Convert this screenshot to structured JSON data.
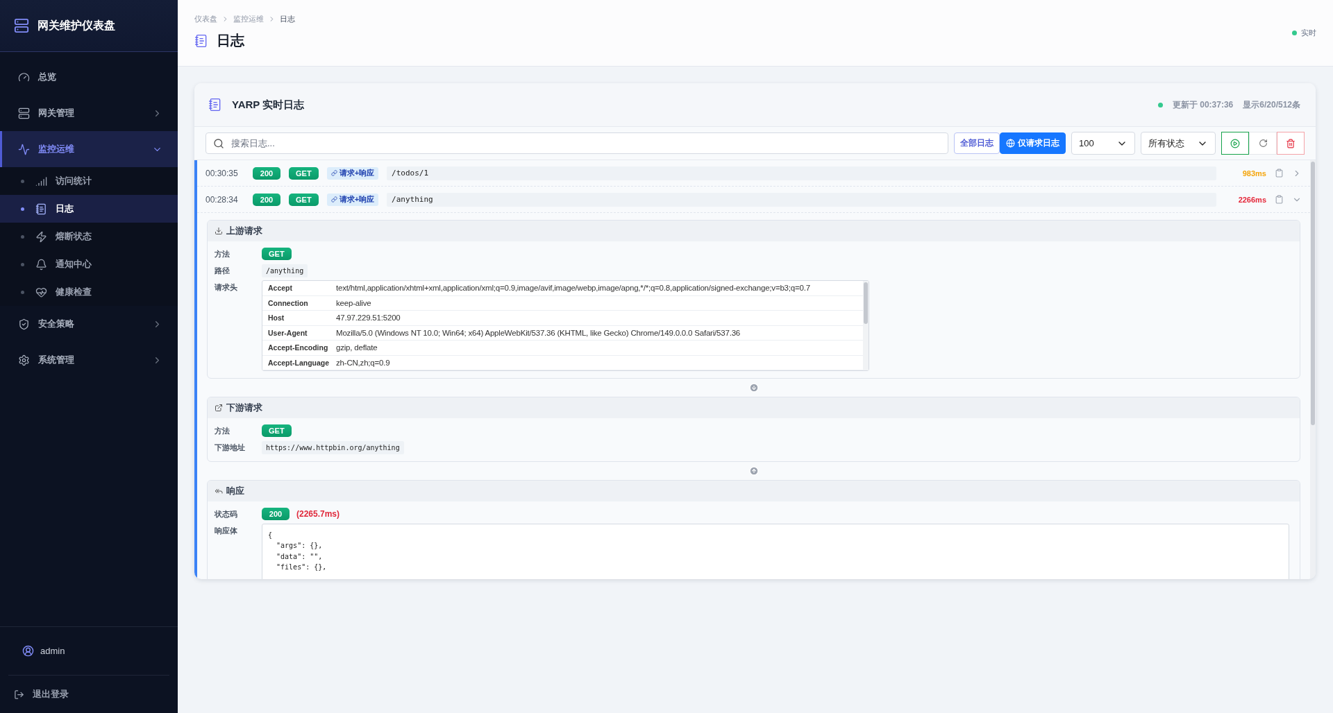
{
  "sidebar": {
    "title": "网关维护仪表盘",
    "items": [
      {
        "kind": "link",
        "label": "总览",
        "selected": false
      },
      {
        "kind": "group",
        "label": "网关管理",
        "selected": false,
        "expanded": false
      },
      {
        "kind": "group",
        "label": "监控运维",
        "selected": true,
        "expanded": true,
        "children": [
          {
            "label": "访问统计",
            "selected": false
          },
          {
            "label": "日志",
            "selected": true
          },
          {
            "label": "熔断状态",
            "selected": false
          },
          {
            "label": "通知中心",
            "selected": false
          },
          {
            "label": "健康检查",
            "selected": false
          }
        ]
      },
      {
        "kind": "group",
        "label": "安全策略",
        "selected": false,
        "expanded": false
      },
      {
        "kind": "group",
        "label": "系统管理",
        "selected": false,
        "expanded": false
      }
    ],
    "user": "admin",
    "logout": "退出登录"
  },
  "header": {
    "breadcrumb": [
      "仪表盘",
      "监控运维",
      "日志"
    ],
    "title": "日志",
    "live": "实时"
  },
  "card": {
    "title": "YARP 实时日志",
    "updated": "更新于 00:37:36",
    "count": "显示6/20/512条"
  },
  "toolbar": {
    "search_placeholder": "搜索日志...",
    "filters": [
      {
        "label": "全部日志",
        "selected": false
      },
      {
        "label": "仅请求日志",
        "selected": true
      }
    ],
    "limit": "100",
    "status_filter": "所有状态"
  },
  "logs": [
    {
      "time": "00:30:35",
      "status": "200",
      "method": "GET",
      "tag": "请求+响应",
      "path": "/todos/1",
      "duration": "983ms",
      "color": "#f5a50b",
      "expanded": false
    },
    {
      "time": "00:28:34",
      "status": "200",
      "method": "GET",
      "tag": "请求+响应",
      "path": "/anything",
      "duration": "2266ms",
      "color": "#e5283a",
      "expanded": true
    }
  ],
  "detail": {
    "upstream": {
      "title": "上游请求",
      "method_label": "方法",
      "method": "GET",
      "path_label": "路径",
      "path": "/anything",
      "headers_label": "请求头",
      "headers": [
        {
          "name": "Accept",
          "value": "text/html,application/xhtml+xml,application/xml;q=0.9,image/avif,image/webp,image/apng,*/*;q=0.8,application/signed-exchange;v=b3;q=0.7"
        },
        {
          "name": "Connection",
          "value": "keep-alive"
        },
        {
          "name": "Host",
          "value": "47.97.229.51:5200"
        },
        {
          "name": "User-Agent",
          "value": "Mozilla/5.0 (Windows NT 10.0; Win64; x64) AppleWebKit/537.36 (KHTML, like Gecko) Chrome/149.0.0.0 Safari/537.36"
        },
        {
          "name": "Accept-Encoding",
          "value": "gzip, deflate"
        },
        {
          "name": "Accept-Language",
          "value": "zh-CN,zh;q=0.9"
        }
      ]
    },
    "downstream": {
      "title": "下游请求",
      "method_label": "方法",
      "method": "GET",
      "url_label": "下游地址",
      "url": "https://www.httpbin.org/anything"
    },
    "response": {
      "title": "响应",
      "status_label": "状态码",
      "status": "200",
      "duration": "(2265.7ms)",
      "body_label": "响应体",
      "body": [
        "{",
        "  \"args\": {},",
        "  \"data\": \"\",",
        "  \"files\": {},"
      ]
    }
  }
}
